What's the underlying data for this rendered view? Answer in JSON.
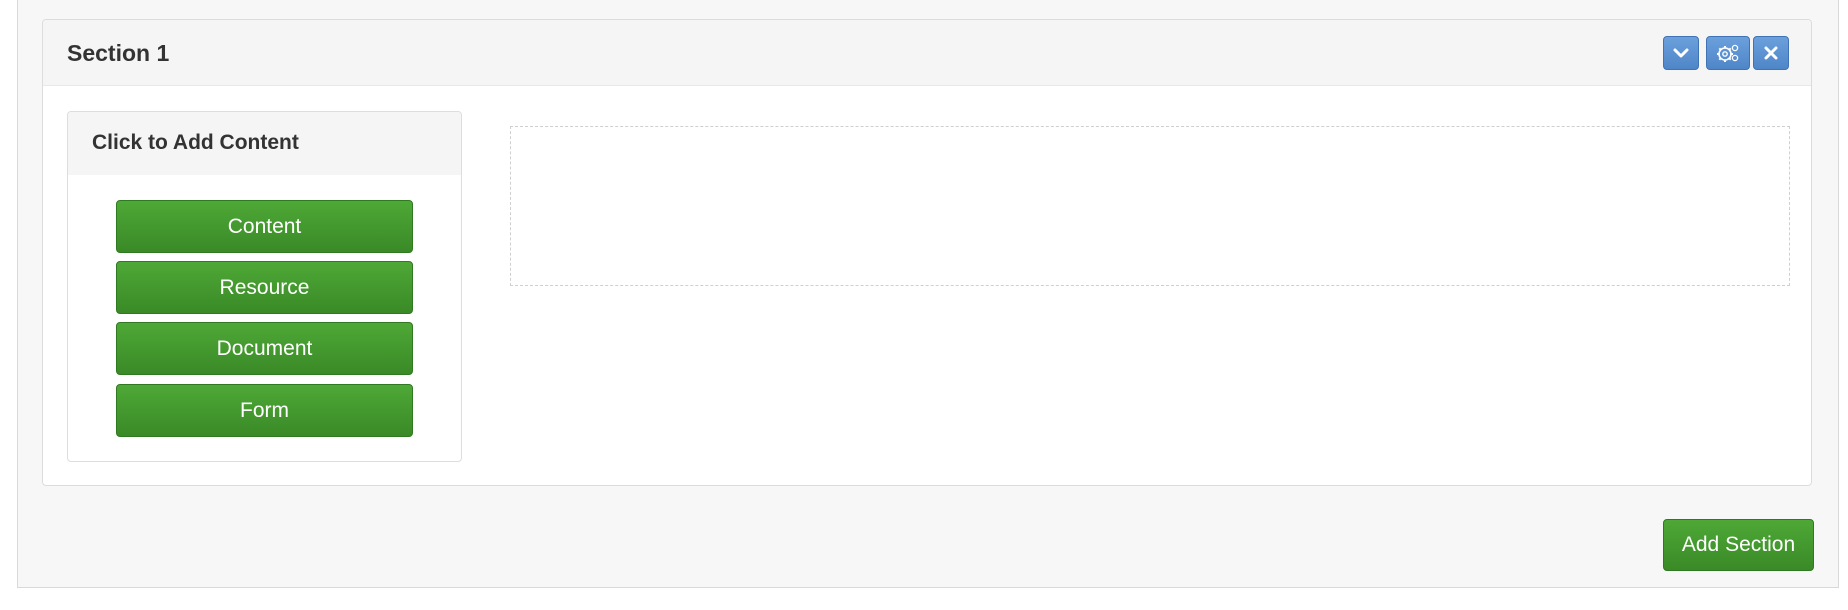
{
  "section": {
    "title": "Section 1",
    "controls": {
      "collapse_icon": "chevron-down-icon",
      "settings_icon": "gears-icon",
      "remove_icon": "close-icon"
    }
  },
  "add_content": {
    "title": "Click to Add Content",
    "buttons": [
      "Content",
      "Resource",
      "Document",
      "Form"
    ]
  },
  "footer": {
    "add_section_label": "Add Section"
  },
  "colors": {
    "primary_blue": "#5b92d3",
    "success_green": "#43992f",
    "panel_header_bg": "#f5f5f5"
  }
}
